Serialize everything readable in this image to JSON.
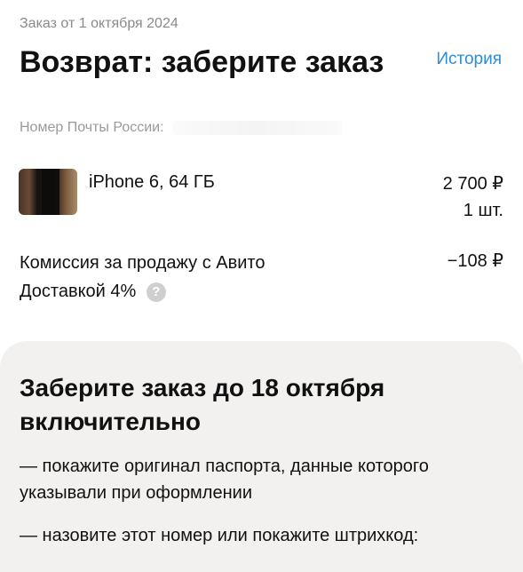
{
  "header": {
    "order_date": "Заказ от 1 октября 2024",
    "title": "Возврат: заберите заказ",
    "history_link": "История",
    "post_number_label": "Номер Почты России:"
  },
  "item": {
    "title": "iPhone 6, 64 ГБ",
    "price": "2 700 ₽",
    "quantity": "1 шт."
  },
  "commission": {
    "label": "Комиссия за продажу с Авито Доставкой 4%",
    "value": "−108 ₽",
    "help_icon_glyph": "?"
  },
  "pickup": {
    "title": "Заберите заказ до 18 октября включительно",
    "step_1": "— покажите оригинал паспорта, данные которого указывали при оформлении",
    "step_2": "— назовите этот номер или покажите штрихкод:"
  },
  "colors": {
    "accent_link": "#2f8cd8",
    "card_background": "#f2f1ef"
  }
}
